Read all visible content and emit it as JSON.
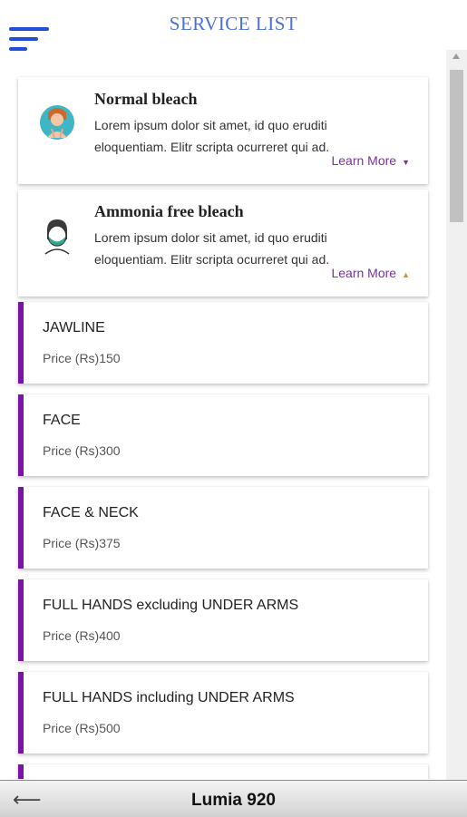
{
  "header": {
    "title": "SERVICE LIST"
  },
  "bleach_cards": [
    {
      "title": "Normal bleach",
      "description": "Lorem ipsum dolor sit amet, id quo eruditi eloquentiam. Elitr scripta ocurreret qui ad.",
      "learn_more": "Learn More",
      "icon": "woman-face-icon",
      "arrow": "▼"
    },
    {
      "title": "Ammonia free bleach",
      "description": "Lorem ipsum dolor sit amet, id quo eruditi eloquentiam. Elitr scripta ocurreret qui ad.",
      "learn_more": "Learn More",
      "icon": "masked-face-icon",
      "arrow": "▲"
    }
  ],
  "services": [
    {
      "name": "JAWLINE",
      "price": "Price (Rs)150"
    },
    {
      "name": "FACE",
      "price": "Price (Rs)300"
    },
    {
      "name": "FACE & NECK",
      "price": "Price (Rs)375"
    },
    {
      "name": "FULL HANDS excluding UNDER ARMS",
      "price": "Price (Rs)400"
    },
    {
      "name": "FULL HANDS including UNDER ARMS",
      "price": "Price (Rs)500"
    },
    {
      "name": "",
      "price": ""
    }
  ],
  "bottom_bar": {
    "back": "⟵",
    "device": "Lumia 920"
  },
  "colors": {
    "accent": "#7a14a8",
    "title": "#4a6fe0",
    "menu": "#1f4ed6"
  }
}
